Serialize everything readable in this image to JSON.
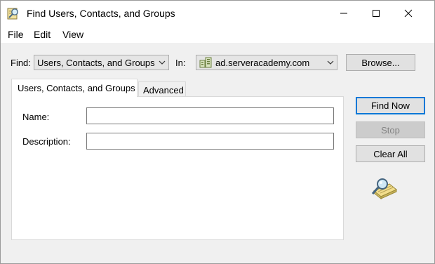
{
  "window": {
    "title": "Find Users, Contacts, and Groups",
    "icon": "find-users-app-icon"
  },
  "menu": {
    "items": [
      {
        "label": "File"
      },
      {
        "label": "Edit"
      },
      {
        "label": "View"
      }
    ]
  },
  "find_row": {
    "find_label": "Find:",
    "find_value": "Users, Contacts, and Groups",
    "in_label": "In:",
    "in_value": "ad.serveracademy.com",
    "browse_label": "Browse..."
  },
  "tabs": [
    {
      "label": "Users, Contacts, and Groups",
      "selected": true
    },
    {
      "label": "Advanced",
      "selected": false
    }
  ],
  "form": {
    "name_label": "Name:",
    "name_value": "",
    "description_label": "Description:",
    "description_value": ""
  },
  "actions": {
    "find_now": "Find Now",
    "stop": "Stop",
    "clear_all": "Clear All"
  },
  "colors": {
    "window_bg": "#f0f0f0",
    "focus_border": "#0078d7"
  }
}
